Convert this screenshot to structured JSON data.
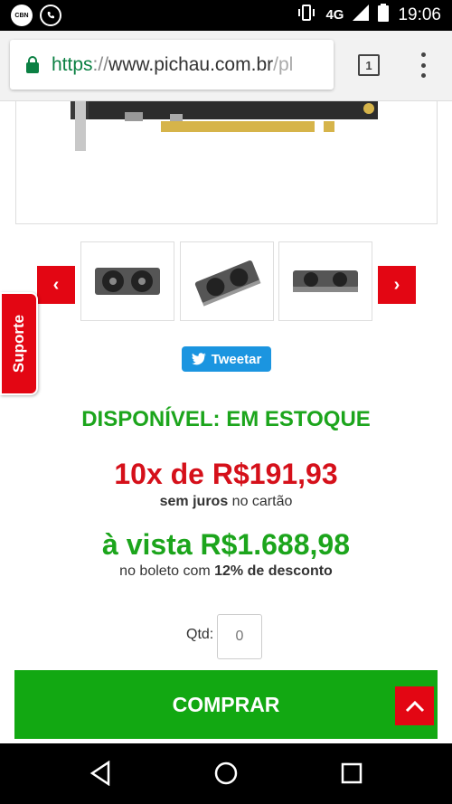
{
  "status_bar": {
    "network": "4G",
    "time": "19:06",
    "left_icons": [
      "cbn-icon",
      "whatsapp-icon"
    ],
    "cbn_badge": "CBN"
  },
  "browser": {
    "url_scheme": "https",
    "url_sep": "://",
    "url_host": "www.pichau.com.br",
    "url_rest": "/pl",
    "tab_count": "1"
  },
  "gallery": {
    "prev_label": "‹",
    "next_label": "›"
  },
  "support": {
    "label": "Suporte"
  },
  "tweet": {
    "label": "Tweetar"
  },
  "product": {
    "availability": "DISPONÍVEL: EM ESTOQUE",
    "installments": "10x de R$191,93",
    "installments_note_bold": "sem juros",
    "installments_note_rest": " no cartão",
    "cash_price": "à vista R$1.688,98",
    "cash_note_pre": "no boleto com ",
    "cash_note_bold": "12% de desconto"
  },
  "quantity": {
    "label": "Qtd:",
    "placeholder": "0"
  },
  "buy": {
    "label": "COMPRAR"
  },
  "colors": {
    "brand_red": "#e30613",
    "stock_green": "#1ca51c",
    "buy_green": "#12a812",
    "twitter_blue": "#1b95e0"
  }
}
